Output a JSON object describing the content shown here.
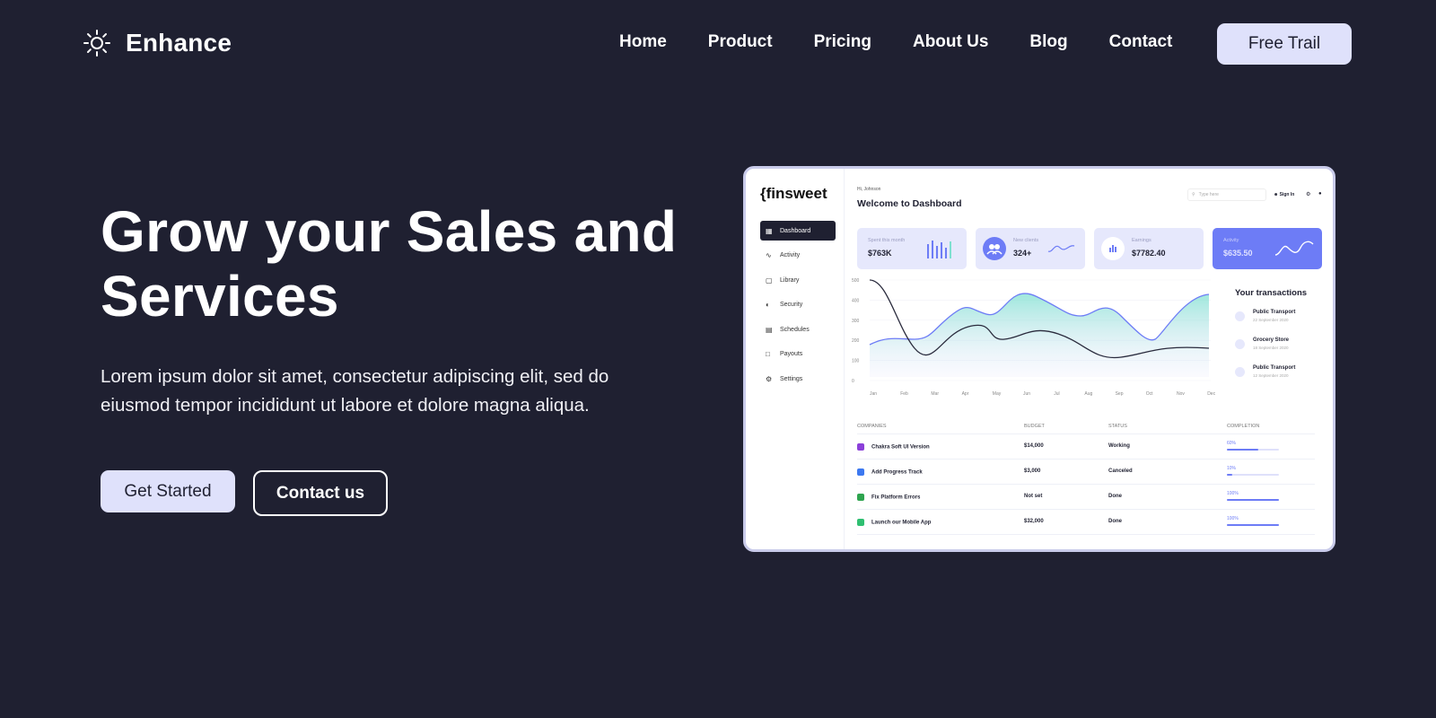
{
  "brand": {
    "name": "Enhance",
    "icon": "sun-icon"
  },
  "nav": {
    "items": [
      "Home",
      "Product",
      "Pricing",
      "About Us",
      "Blog",
      "Contact"
    ],
    "cta": "Free Trail"
  },
  "hero": {
    "title_line1": "Grow your Sales and",
    "title_line2": "Services",
    "description_line1": "Lorem ipsum dolor sit amet, consectetur adipiscing elit, sed do",
    "description_line2": "eiusmod tempor incididunt ut labore et dolore magna aliqua.",
    "primary_button": "Get Started",
    "secondary_button": "Contact us"
  },
  "colors": {
    "background": "#1f2031",
    "accent_light": "#dfe1fb",
    "accent_blue": "#6d7cf6",
    "chart_fill": "#7ee0d0"
  },
  "dashboard": {
    "logo": "{finsweet",
    "user": "Hi, Johnson",
    "welcome": "Welcome to Dashboard",
    "search_placeholder": "Type here",
    "sign_in": "Sign In",
    "sidebar": [
      {
        "label": "Dashboard",
        "icon": "grid-icon",
        "active": true
      },
      {
        "label": "Activity",
        "icon": "activity-icon"
      },
      {
        "label": "Library",
        "icon": "library-icon"
      },
      {
        "label": "Security",
        "icon": "shield-icon"
      },
      {
        "label": "Schedules",
        "icon": "calendar-icon"
      },
      {
        "label": "Payouts",
        "icon": "wallet-icon"
      },
      {
        "label": "Settings",
        "icon": "gear-icon"
      }
    ],
    "cards": [
      {
        "label": "Spent this month",
        "value": "$763K"
      },
      {
        "label": "New clients",
        "value": "324+"
      },
      {
        "label": "Earnings",
        "value": "$7782.40"
      },
      {
        "label": "Activity",
        "value": "$635.50"
      }
    ],
    "chart_yticks": [
      "500",
      "400",
      "300",
      "200",
      "100",
      "0"
    ],
    "chart_months": [
      "Jan",
      "Feb",
      "Mar",
      "Apr",
      "May",
      "Jun",
      "Jul",
      "Aug",
      "Sep",
      "Oct",
      "Nov",
      "Dec"
    ],
    "transactions_title": "Your transactions",
    "transactions": [
      {
        "name": "Public Transport",
        "date": "22 September 2020"
      },
      {
        "name": "Grocery Store",
        "date": "18 September 2020"
      },
      {
        "name": "Public Transport",
        "date": "12 September 2020"
      }
    ],
    "table_headers": [
      "COMPANIES",
      "BUDGET",
      "STATUS",
      "COMPLETION"
    ],
    "table_rows": [
      {
        "company": "Chakra Soft UI Version",
        "budget": "$14,000",
        "status": "Working",
        "completion": "60%",
        "completion_value": 0.6,
        "icon_color": "#8b3fd9"
      },
      {
        "company": "Add Progress Track",
        "budget": "$3,000",
        "status": "Canceled",
        "completion": "10%",
        "completion_value": 0.1,
        "icon_color": "#3c78f0"
      },
      {
        "company": "Fix Platform Errors",
        "budget": "Not set",
        "status": "Done",
        "completion": "100%",
        "completion_value": 1.0,
        "icon_color": "#2ea44f"
      },
      {
        "company": "Launch our Mobile App",
        "budget": "$32,000",
        "status": "Done",
        "completion": "100%",
        "completion_value": 1.0,
        "icon_color": "#2fbf71"
      }
    ]
  }
}
